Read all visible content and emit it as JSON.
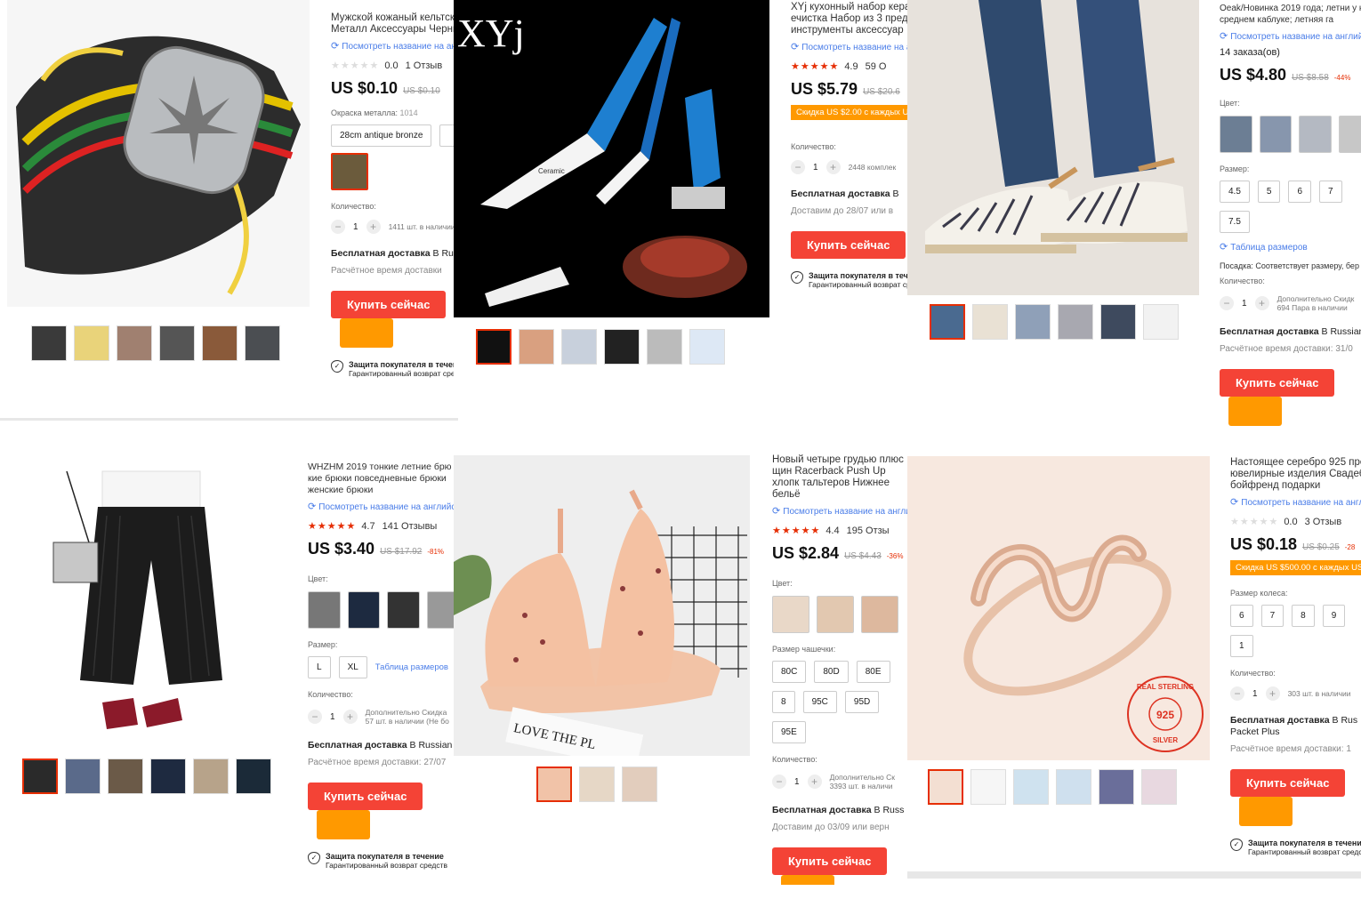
{
  "common": {
    "translate_link": "Посмотреть название на английском",
    "buy_now": "Купить сейчас",
    "free_shipping": "Бесплатная доставка",
    "color_label": "Цвет:",
    "qty_label": "Количество:",
    "size_table": "Таблица размеров",
    "protection_title": "Защита покупателя в течение",
    "protection_sub": "Гарантированный возврат средств"
  },
  "p1": {
    "title": "Мужской кожаный кельтск Металл Аксессуары Черны",
    "rating": "0.0",
    "reviews": "1 Отзыв",
    "price": "US $0.10",
    "old_price": "US $0.10",
    "metal_label": "Окраска металла:",
    "metal_count": "1014",
    "option": "28cm antique bronze",
    "qty": "1",
    "avail": "1411 шт. в наличии",
    "ship_to": "В Russia",
    "eta": "Расчётное время доставки"
  },
  "p2": {
    "brand": "XYj",
    "blade_text": "Ceramic",
    "title": "XYj кухонный набор кера ечистка Набор из 3 пред инструменты аксессуар",
    "rating": "4.9",
    "reviews": "59 О",
    "price": "US $5.79",
    "old_price": "US $20.6",
    "coupon": "Скидка US $2.00 с каждых U",
    "qty": "1",
    "avail": "2448 комплек",
    "ship_to": "В",
    "eta": "Доставим до 28/07 или в"
  },
  "p3": {
    "title": "Oeak/Новинка 2019 года; летни у на среднем каблуке; летняя га",
    "orders": "14 заказа(ов)",
    "price": "US $4.80",
    "old_price": "US $8.58",
    "discount": "-44%",
    "size_label": "Размер:",
    "sizes": [
      "4.5",
      "5",
      "6",
      "7",
      "7.5"
    ],
    "fit": "Посадка: Соответствует размеру, бер",
    "qty": "1",
    "avail_1": "Дополнительно Скидк",
    "avail_2": "694 Пара в наличии",
    "ship_to": "В Russian",
    "eta": "Расчётное время доставки: 31/0"
  },
  "p4": {
    "title": "WHZHM 2019 тонкие летние брю кие брюки повседневные брюки женские брюки",
    "rating": "4.7",
    "reviews": "141 Отзывы",
    "price": "US $3.40",
    "old_price": "US $17.92",
    "discount": "-81%",
    "size_label": "Размер:",
    "sizes": [
      "L",
      "XL"
    ],
    "qty": "1",
    "avail_1": "Дополнительно Скидка",
    "avail_2": "57 шт. в наличии (Не бо",
    "ship_to": "В Russian",
    "eta": "Расчётное время доставки: 27/07"
  },
  "p5": {
    "print_text": "LOVE THE PL",
    "title": "Новый четыре грудью плюс Р щин Racerback Push Up хлопк тальтеров Нижнее бельё",
    "rating": "4.4",
    "reviews": "195 Отзы",
    "price": "US $2.84",
    "old_price": "US $4.43",
    "discount": "-36%",
    "cup_label": "Размер чашечки:",
    "cups": [
      "80C",
      "80D",
      "80E",
      "8",
      "95C",
      "95D",
      "95E"
    ],
    "qty": "1",
    "avail_1": "Дополнительно Ск",
    "avail_2": "3393 шт. в наличи",
    "ship_to": "В Russ",
    "eta": "Доставим до 03/09 или верн"
  },
  "p6": {
    "stamp_top": "REAL STERLING",
    "stamp_num": "925",
    "stamp_bottom": "SILVER",
    "title": "Настоящее серебро 925 про ювелирные изделия Свадеб бойфренд подарки",
    "rating": "0.0",
    "reviews": "3 Отзыв",
    "price": "US $0.18",
    "old_price": "US $0.25",
    "discount": "-28",
    "coupon": "Скидка US $500.00 с каждых US",
    "ring_label": "Размер колеса:",
    "rings": [
      "6",
      "7",
      "8",
      "9",
      "1"
    ],
    "qty": "1",
    "avail": "303 шт. в наличии",
    "ship_to": "В Rus",
    "ship_line2": "Packet Plus",
    "eta": "Расчётное время доставки: 1"
  }
}
